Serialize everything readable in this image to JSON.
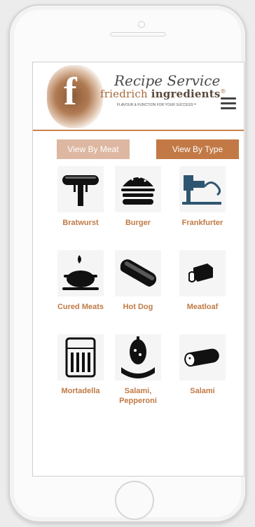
{
  "header": {
    "script_title": "Recipe Service",
    "brand_light": "friedrich",
    "brand_bold": "ingredients",
    "brand_mark": "®",
    "tagline": "FLAVOUR & FUNCTION FOR YOUR SUCCESS™",
    "logo_letter": "f"
  },
  "filters": {
    "by_meat": "View By Meat",
    "by_type": "View By Type"
  },
  "items": [
    {
      "label": "Bratwurst",
      "icon": "bratwurst-icon"
    },
    {
      "label": "Burger",
      "icon": "burger-icon"
    },
    {
      "label": "Frankfurter",
      "icon": "frankfurter-icon"
    },
    {
      "label": "Cured Meats",
      "icon": "cured-meats-icon"
    },
    {
      "label": "Hot Dog",
      "icon": "hot-dog-icon"
    },
    {
      "label": "Meatloaf",
      "icon": "meatloaf-icon"
    },
    {
      "label": "Mortadella",
      "icon": "mortadella-icon"
    },
    {
      "label": "Salami, Pepperoni",
      "icon": "salami-pepperoni-icon"
    },
    {
      "label": "Salami",
      "icon": "salami-icon"
    }
  ],
  "colors": {
    "accent": "#c27945",
    "accent_light": "#ddb7a1",
    "label": "#c07a45"
  }
}
